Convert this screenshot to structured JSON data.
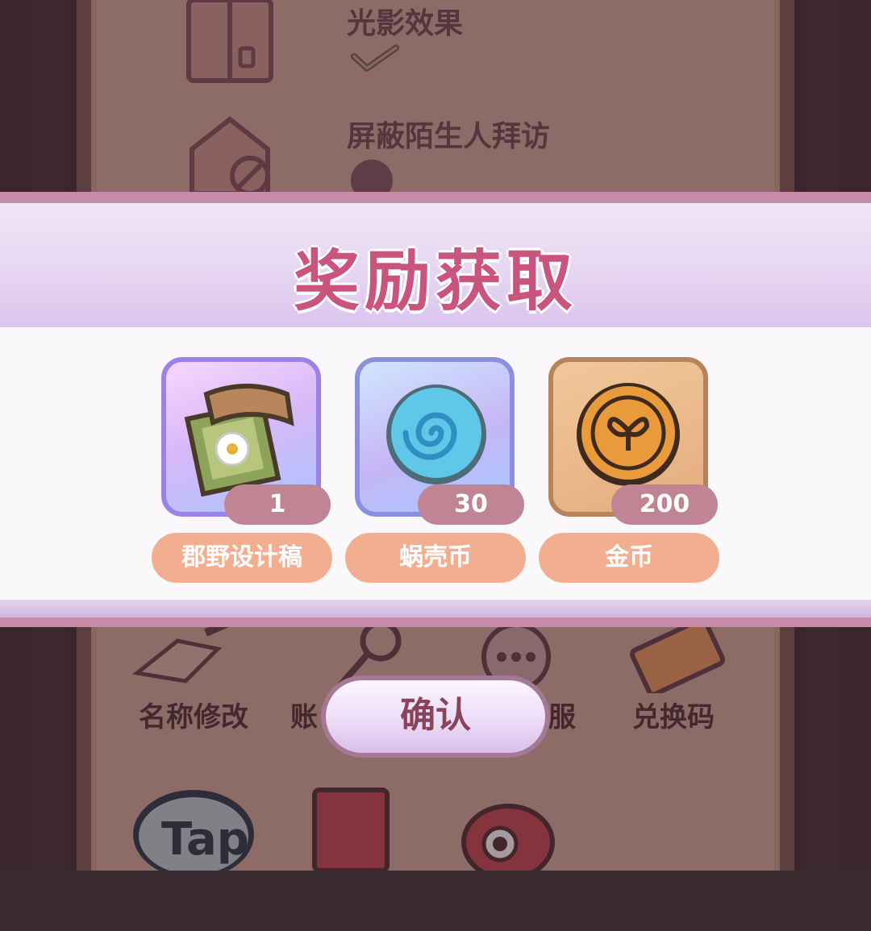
{
  "background": {
    "settings": [
      {
        "label": "光影效果",
        "icon": "window-icon",
        "control": "checked"
      },
      {
        "label": "屏蔽陌生人拜访",
        "icon": "house-block-icon",
        "control": "unchecked"
      }
    ],
    "grid_row1": [
      {
        "label": "名称修改",
        "icon": "pencil-icon"
      },
      {
        "label": "账",
        "icon": "key-icon"
      },
      {
        "label": "服",
        "icon": "headset-icon"
      },
      {
        "label": "兑换码",
        "icon": "ticket-icon"
      }
    ],
    "grid_row2": [
      {
        "label": "Tap",
        "icon": "taptap-icon"
      },
      {
        "label": "",
        "icon": "book-icon"
      },
      {
        "label": "",
        "icon": "weibo-icon"
      }
    ]
  },
  "modal": {
    "title": "奖励获取",
    "rewards": [
      {
        "name": "郡野设计稿",
        "count": "1",
        "icon": "blueprint-scroll-icon",
        "rarity_color": "#9c82e6"
      },
      {
        "name": "蜗壳币",
        "count": "30",
        "icon": "snail-shell-coin-icon",
        "rarity_color": "#8a8fe0"
      },
      {
        "name": "金币",
        "count": "200",
        "icon": "gold-coin-icon",
        "rarity_color": "#b7835a"
      }
    ],
    "confirm_label": "确认"
  },
  "colors": {
    "title": "#c9557e",
    "badge": "#c08595",
    "name_pill": "#f3ae90"
  }
}
